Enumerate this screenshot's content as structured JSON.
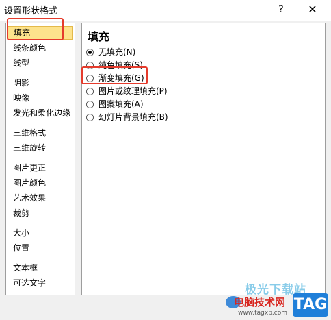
{
  "window": {
    "title": "设置形状格式",
    "help_label": "?",
    "close_label": "✕"
  },
  "sidebar": {
    "groups": [
      [
        "填充",
        "线条颜色",
        "线型"
      ],
      [
        "阴影",
        "映像",
        "发光和柔化边缘"
      ],
      [
        "三维格式",
        "三维旋转"
      ],
      [
        "图片更正",
        "图片颜色",
        "艺术效果",
        "裁剪"
      ],
      [
        "大小",
        "位置"
      ],
      [
        "文本框",
        "可选文字"
      ]
    ],
    "selected": "填充"
  },
  "main": {
    "title": "填充",
    "options": [
      {
        "label": "无填充(N)",
        "checked": true
      },
      {
        "label": "纯色填充(S)",
        "checked": false
      },
      {
        "label": "渐变填充(G)",
        "checked": false
      },
      {
        "label": "图片或纹理填充(P)",
        "checked": false
      },
      {
        "label": "图案填充(A)",
        "checked": false
      },
      {
        "label": "幻灯片背景填充(B)",
        "checked": false
      }
    ]
  },
  "watermark": {
    "top_text": "极光下载站",
    "site_name": "电脑技术网",
    "url": "www.tagxp.com",
    "badge": "TAG"
  },
  "colors": {
    "highlight_box": "#e53b2c",
    "selected_bg": "#fde38c",
    "tag_badge": "#1f7fd9"
  }
}
